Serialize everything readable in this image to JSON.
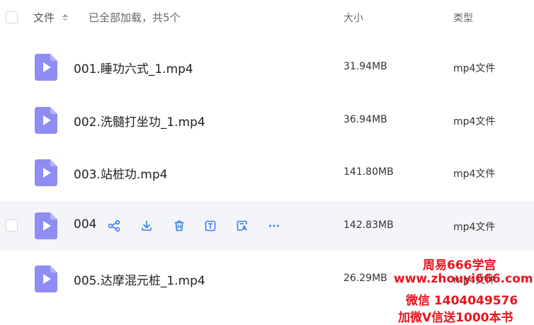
{
  "header": {
    "name_label": "文件",
    "status_text": "已全部加载，共5个",
    "size_label": "大小",
    "type_label": "类型"
  },
  "files": [
    {
      "name": "001.睡功六式_1.mp4",
      "size": "31.94MB",
      "type": "mp4文件"
    },
    {
      "name": "002.洗髓打坐功_1.mp4",
      "size": "36.94MB",
      "type": "mp4文件"
    },
    {
      "name": "003.站桩功.mp4",
      "size": "141.80MB",
      "type": "mp4文件"
    },
    {
      "name": "004.",
      "size": "142.83MB",
      "type": "mp4文件"
    },
    {
      "name": "005.达摩混元桩_1.mp4",
      "size": "26.29MB",
      "type": "mp4文件"
    }
  ],
  "actions": [
    "share-icon",
    "download-icon",
    "delete-icon",
    "text-icon",
    "image-text-icon",
    "more-icon"
  ],
  "watermark": {
    "line1": "周易666学宫",
    "line2": "www.zhouyi666.com",
    "line3": "微信 1404049576",
    "line4": "加微V信送1000本书"
  },
  "colors": {
    "file_icon": "#8f8cf3",
    "action_icon": "#3b7ded",
    "watermark": "#e8141e",
    "hover_row": "#f4f5f8"
  }
}
